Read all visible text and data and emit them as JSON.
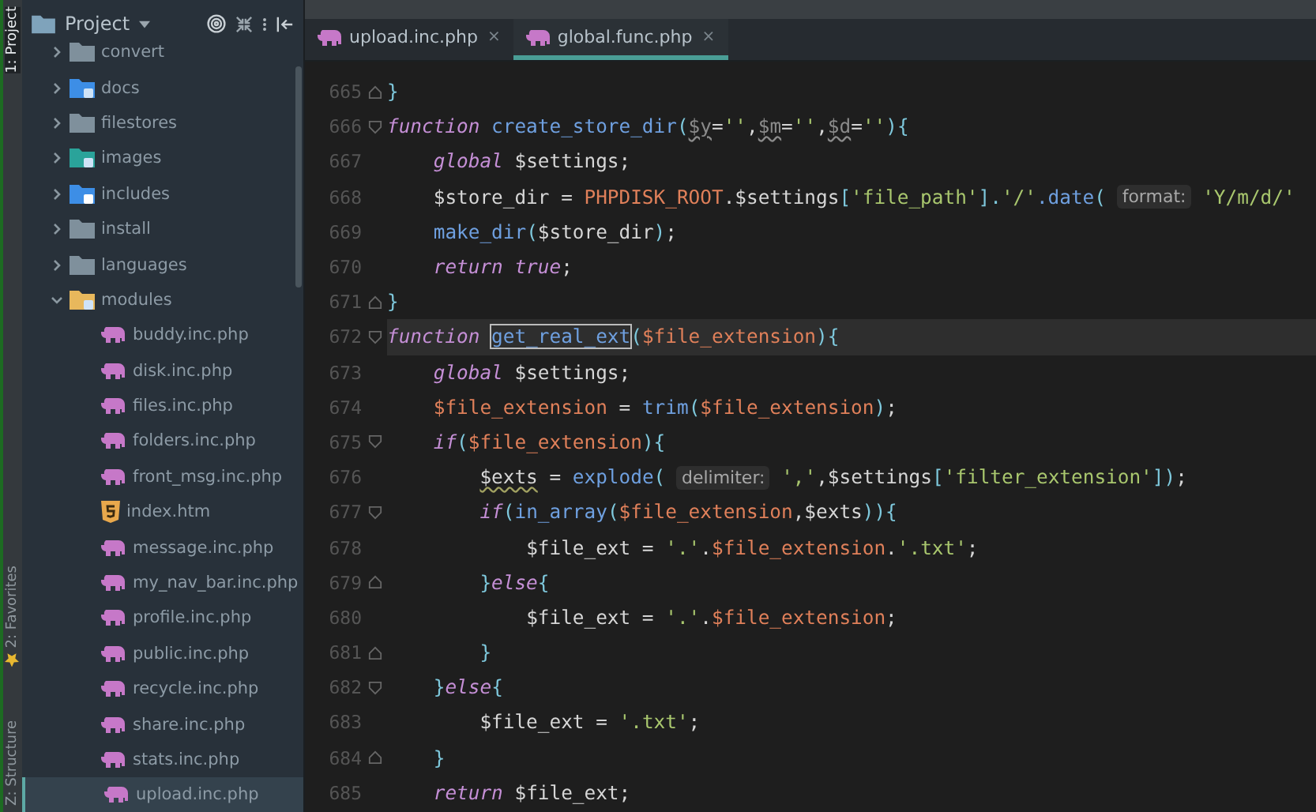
{
  "side_tools": [
    {
      "label": "1: Project",
      "kind": "top",
      "selected": true
    },
    {
      "label": "2: Favorites",
      "kind": "star",
      "selected": false
    },
    {
      "label": "Z: Structure",
      "kind": "bottom",
      "selected": false
    }
  ],
  "project_panel": {
    "title": "Project",
    "tree": [
      {
        "label": "convert",
        "kind": "folder",
        "expanded": false
      },
      {
        "label": "docs",
        "kind": "docfolder",
        "expanded": false
      },
      {
        "label": "filestores",
        "kind": "folder",
        "expanded": false
      },
      {
        "label": "images",
        "kind": "imgfolder",
        "expanded": false
      },
      {
        "label": "includes",
        "kind": "gearfolder",
        "expanded": false
      },
      {
        "label": "install",
        "kind": "folder",
        "expanded": false
      },
      {
        "label": "languages",
        "kind": "folder",
        "expanded": false
      },
      {
        "label": "modules",
        "kind": "modfolder",
        "expanded": true,
        "children": [
          {
            "label": "buddy.inc.php",
            "kind": "php",
            "selected": false
          },
          {
            "label": "disk.inc.php",
            "kind": "php",
            "selected": false
          },
          {
            "label": "files.inc.php",
            "kind": "php",
            "selected": false
          },
          {
            "label": "folders.inc.php",
            "kind": "php",
            "selected": false
          },
          {
            "label": "front_msg.inc.php",
            "kind": "php",
            "selected": false
          },
          {
            "label": "index.htm",
            "kind": "html",
            "selected": false
          },
          {
            "label": "message.inc.php",
            "kind": "php",
            "selected": false
          },
          {
            "label": "my_nav_bar.inc.php",
            "kind": "php",
            "selected": false
          },
          {
            "label": "profile.inc.php",
            "kind": "php",
            "selected": false
          },
          {
            "label": "public.inc.php",
            "kind": "php",
            "selected": false
          },
          {
            "label": "recycle.inc.php",
            "kind": "php",
            "selected": false
          },
          {
            "label": "share.inc.php",
            "kind": "php",
            "selected": false
          },
          {
            "label": "stats.inc.php",
            "kind": "php",
            "selected": false
          },
          {
            "label": "upload.inc.php",
            "kind": "php",
            "selected": true
          }
        ]
      }
    ]
  },
  "tabs": [
    {
      "label": "upload.inc.php",
      "close": "×",
      "selected": false
    },
    {
      "label": "global.func.php",
      "close": "×",
      "selected": true
    }
  ],
  "code": [
    {
      "number": "665",
      "kind": "fold_end",
      "current": false,
      "tokens": [
        {
          "kind": "punct",
          "text": "}"
        }
      ]
    },
    {
      "number": "666",
      "kind": "fold_start",
      "current": false,
      "tokens": [
        {
          "kind": "kw",
          "text": "function"
        },
        {
          "kind": "fn",
          "text": " create_store_dir"
        },
        {
          "kind": "punct",
          "text": "("
        },
        {
          "kind": "param",
          "text": "$y"
        },
        {
          "kind": "plain",
          "text": "="
        },
        {
          "kind": "str",
          "text": "''"
        },
        {
          "kind": "plain",
          "text": ","
        },
        {
          "kind": "param",
          "text": "$m"
        },
        {
          "kind": "plain",
          "text": "="
        },
        {
          "kind": "str",
          "text": "''"
        },
        {
          "kind": "plain",
          "text": ","
        },
        {
          "kind": "param",
          "text": "$d"
        },
        {
          "kind": "plain",
          "text": "="
        },
        {
          "kind": "str",
          "text": "''"
        },
        {
          "kind": "punct",
          "text": "){"
        }
      ]
    },
    {
      "number": "667",
      "kind": "plain",
      "current": false,
      "tokens": [
        {
          "kind": "kw",
          "text": "    global"
        },
        {
          "kind": "plain",
          "text": " $settings;"
        }
      ]
    },
    {
      "number": "668",
      "kind": "plain",
      "current": false,
      "tokens": [
        {
          "kind": "plain",
          "text": "    $store_dir = "
        },
        {
          "kind": "const",
          "text": "PHPDISK_ROOT"
        },
        {
          "kind": "plain",
          "text": ".$settings"
        },
        {
          "kind": "punct",
          "text": "["
        },
        {
          "kind": "str",
          "text": "'file_path'"
        },
        {
          "kind": "punct",
          "text": "]."
        },
        {
          "kind": "str",
          "text": "'/'"
        },
        {
          "kind": "fn",
          "text": ".date"
        },
        {
          "kind": "punct",
          "text": "( "
        },
        {
          "kind": "hint",
          "text": "format:"
        },
        {
          "kind": "str",
          "text": " 'Y/m/d/'"
        }
      ]
    },
    {
      "number": "669",
      "kind": "plain",
      "current": false,
      "tokens": [
        {
          "kind": "fn",
          "text": "    make_dir"
        },
        {
          "kind": "punct",
          "text": "("
        },
        {
          "kind": "plain",
          "text": "$store_dir"
        },
        {
          "kind": "punct",
          "text": ")"
        },
        {
          "kind": "plain",
          "text": ";"
        }
      ]
    },
    {
      "number": "670",
      "kind": "plain",
      "current": false,
      "tokens": [
        {
          "kind": "kw",
          "text": "    return true"
        },
        {
          "kind": "plain",
          "text": ";"
        }
      ]
    },
    {
      "number": "671",
      "kind": "fold_end",
      "current": false,
      "tokens": [
        {
          "kind": "punct",
          "text": "}"
        }
      ]
    },
    {
      "number": "672",
      "kind": "fold_start",
      "current": true,
      "tokens": [
        {
          "kind": "kw",
          "text": "function "
        },
        {
          "kind": "fn_box",
          "text": "get_real_ext"
        },
        {
          "kind": "punct",
          "text": "("
        },
        {
          "kind": "var",
          "text": "$file_extension"
        },
        {
          "kind": "punct",
          "text": "){"
        }
      ]
    },
    {
      "number": "673",
      "kind": "plain",
      "current": false,
      "tokens": [
        {
          "kind": "kw",
          "text": "    global"
        },
        {
          "kind": "plain",
          "text": " $settings;"
        }
      ]
    },
    {
      "number": "674",
      "kind": "plain",
      "current": false,
      "tokens": [
        {
          "kind": "var",
          "text": "    $file_extension"
        },
        {
          "kind": "plain",
          "text": " = "
        },
        {
          "kind": "fn",
          "text": "trim"
        },
        {
          "kind": "punct",
          "text": "("
        },
        {
          "kind": "var",
          "text": "$file_extension"
        },
        {
          "kind": "punct",
          "text": ")"
        },
        {
          "kind": "plain",
          "text": ";"
        }
      ]
    },
    {
      "number": "675",
      "kind": "fold_start",
      "current": false,
      "tokens": [
        {
          "kind": "kw",
          "text": "    if"
        },
        {
          "kind": "punct",
          "text": "("
        },
        {
          "kind": "var",
          "text": "$file_extension"
        },
        {
          "kind": "punct",
          "text": "){"
        }
      ]
    },
    {
      "number": "676",
      "kind": "plain",
      "current": false,
      "tokens": [
        {
          "kind": "wavy",
          "text": "        $exts"
        },
        {
          "kind": "plain",
          "text": " = "
        },
        {
          "kind": "fn",
          "text": "explode"
        },
        {
          "kind": "punct",
          "text": "( "
        },
        {
          "kind": "hint",
          "text": "delimiter:"
        },
        {
          "kind": "str",
          "text": " ','"
        },
        {
          "kind": "plain",
          "text": ",$settings"
        },
        {
          "kind": "punct",
          "text": "["
        },
        {
          "kind": "str",
          "text": "'filter_extension'"
        },
        {
          "kind": "punct",
          "text": "])"
        },
        {
          "kind": "plain",
          "text": ";"
        }
      ]
    },
    {
      "number": "677",
      "kind": "fold_start",
      "current": false,
      "tokens": [
        {
          "kind": "kw",
          "text": "        if"
        },
        {
          "kind": "punct",
          "text": "("
        },
        {
          "kind": "fn",
          "text": "in_array"
        },
        {
          "kind": "punct",
          "text": "("
        },
        {
          "kind": "var",
          "text": "$file_extension"
        },
        {
          "kind": "plain",
          "text": ",$exts"
        },
        {
          "kind": "punct",
          "text": ")){"
        }
      ]
    },
    {
      "number": "678",
      "kind": "plain",
      "current": false,
      "tokens": [
        {
          "kind": "plain",
          "text": "            $file_ext = "
        },
        {
          "kind": "str",
          "text": "'.'"
        },
        {
          "kind": "plain",
          "text": "."
        },
        {
          "kind": "var",
          "text": "$file_extension"
        },
        {
          "kind": "plain",
          "text": "."
        },
        {
          "kind": "str",
          "text": "'.txt'"
        },
        {
          "kind": "plain",
          "text": ";"
        }
      ]
    },
    {
      "number": "679",
      "kind": "fold_end",
      "current": false,
      "tokens": [
        {
          "kind": "punct",
          "text": "        }"
        },
        {
          "kind": "kw",
          "text": "else"
        },
        {
          "kind": "punct",
          "text": "{"
        }
      ]
    },
    {
      "number": "680",
      "kind": "plain",
      "current": false,
      "tokens": [
        {
          "kind": "plain",
          "text": "            $file_ext = "
        },
        {
          "kind": "str",
          "text": "'.'"
        },
        {
          "kind": "plain",
          "text": "."
        },
        {
          "kind": "var",
          "text": "$file_extension"
        },
        {
          "kind": "plain",
          "text": ";"
        }
      ]
    },
    {
      "number": "681",
      "kind": "fold_end",
      "current": false,
      "tokens": [
        {
          "kind": "punct",
          "text": "        }"
        }
      ]
    },
    {
      "number": "682",
      "kind": "fold_start",
      "current": false,
      "tokens": [
        {
          "kind": "punct",
          "text": "    }"
        },
        {
          "kind": "kw",
          "text": "else"
        },
        {
          "kind": "punct",
          "text": "{"
        }
      ]
    },
    {
      "number": "683",
      "kind": "plain",
      "current": false,
      "tokens": [
        {
          "kind": "plain",
          "text": "        $file_ext = "
        },
        {
          "kind": "str",
          "text": "'.txt'"
        },
        {
          "kind": "plain",
          "text": ";"
        }
      ]
    },
    {
      "number": "684",
      "kind": "fold_end",
      "current": false,
      "tokens": [
        {
          "kind": "punct",
          "text": "    }"
        }
      ]
    },
    {
      "number": "685",
      "kind": "plain",
      "current": false,
      "tokens": [
        {
          "kind": "kw",
          "text": "    return"
        },
        {
          "kind": "plain",
          "text": " $file_ext;"
        }
      ]
    }
  ]
}
